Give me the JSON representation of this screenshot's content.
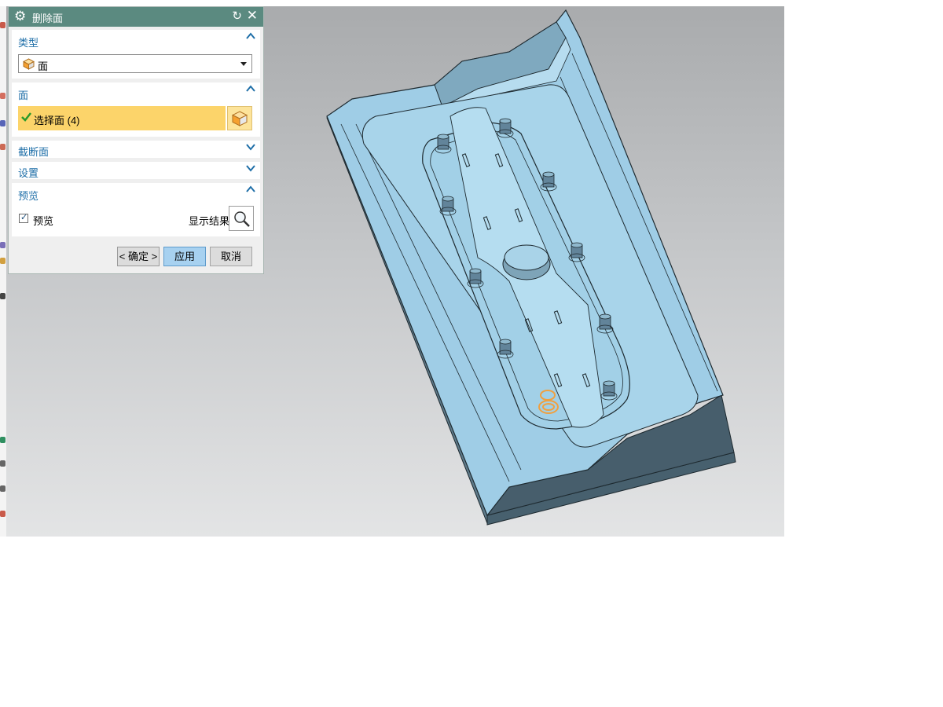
{
  "dialog": {
    "title": "删除面",
    "icons": {
      "settings": "gear-icon",
      "reset": "reset-icon",
      "close": "close-icon"
    },
    "groups": {
      "type": {
        "label": "类型",
        "expanded": true,
        "select_value": "面",
        "select_icon": "face-cube-icon"
      },
      "face": {
        "label": "面",
        "expanded": true,
        "selection_label": "选择面 (4)",
        "selected": true
      },
      "cutface": {
        "label": "截断面",
        "expanded": false
      },
      "settings": {
        "label": "设置",
        "expanded": false
      },
      "preview": {
        "label": "预览",
        "expanded": true,
        "checkbox_label": "预览",
        "checked": true,
        "show_result_label": "显示结果"
      }
    },
    "buttons": {
      "ok": "< 确定 >",
      "apply": "应用",
      "cancel": "取消"
    }
  },
  "colors": {
    "title_bar": "#5b8a80",
    "group_header": "#1f6fa8",
    "selection_highlight": "#fcd46a",
    "apply_button": "#a7d1f0",
    "model_face": "#9fcde6",
    "model_edge": "#1e2a30",
    "model_side": "#47606e",
    "selected_faces": "#f0a040"
  }
}
